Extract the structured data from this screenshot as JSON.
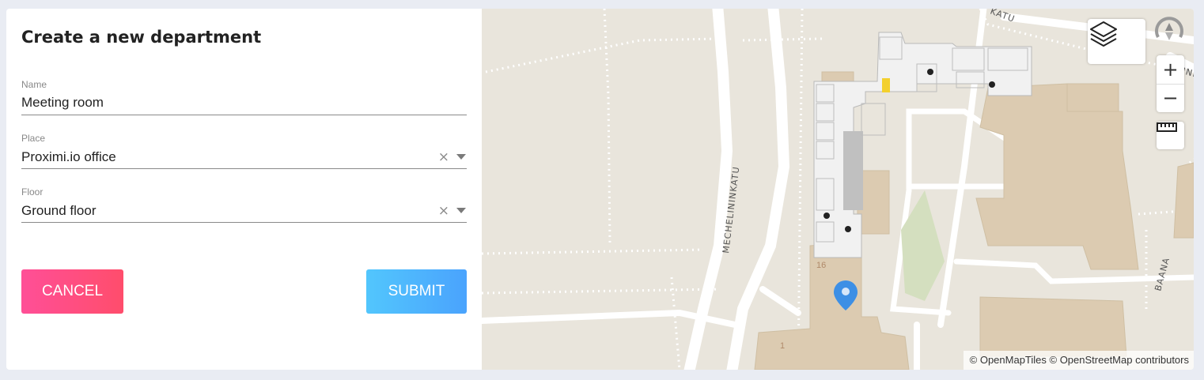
{
  "form": {
    "title": "Create a new department",
    "name_field": {
      "label": "Name",
      "value": "Meeting room"
    },
    "place_field": {
      "label": "Place",
      "value": "Proximi.io office"
    },
    "floor_field": {
      "label": "Floor",
      "value": "Ground floor"
    },
    "cancel_label": "CANCEL",
    "submit_label": "SUBMIT",
    "colors": {
      "cancel": "#ff4d7f",
      "submit": "#4fb3fd"
    }
  },
  "map": {
    "streets": [
      "MECHELININKATU",
      "BAANA",
      "KATU",
      "INI"
    ],
    "building_numbers": [
      "16",
      "1"
    ],
    "attribution": "© OpenMapTiles © OpenStreetMap contributors",
    "controls": {
      "layers": "layers-icon",
      "zoom_in": "+",
      "zoom_out": "−",
      "ruler": "ruler-icon",
      "compass": "compass-icon"
    },
    "marker_color": "#3d8fe5"
  }
}
